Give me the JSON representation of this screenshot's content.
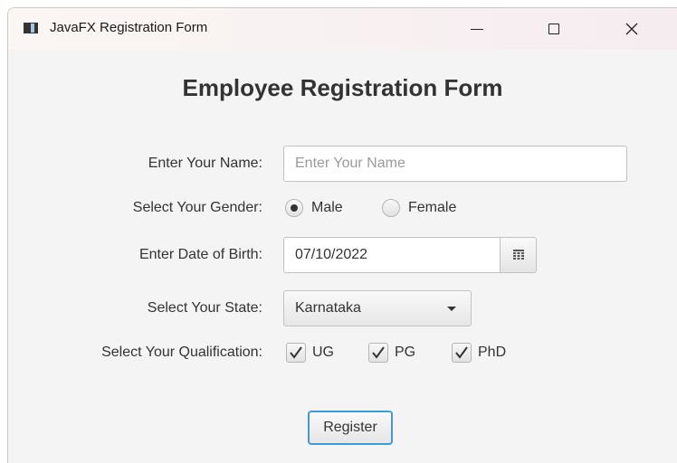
{
  "window": {
    "title": "JavaFX Registration Form"
  },
  "form": {
    "heading": "Employee Registration Form",
    "name_label": "Enter Your Name:",
    "name_placeholder": "Enter Your Name",
    "name_value": "",
    "gender_label": "Select Your Gender:",
    "gender_options": [
      "Male",
      "Female"
    ],
    "gender_selected": "Male",
    "dob_label": "Enter Date of Birth:",
    "dob_value": "07/10/2022",
    "state_label": "Select Your State:",
    "state_selected": "Karnataka",
    "qualification_label": "Select Your Qualification:",
    "qualifications": [
      {
        "label": "UG",
        "checked": true
      },
      {
        "label": "PG",
        "checked": true
      },
      {
        "label": "PhD",
        "checked": true
      }
    ],
    "register_label": "Register"
  },
  "colors": {
    "focus_border": "#3d9bd8",
    "text": "#333333"
  }
}
